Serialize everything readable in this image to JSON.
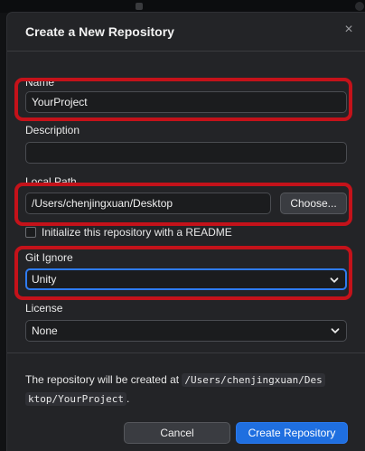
{
  "dialog": {
    "title": "Create a New Repository",
    "close_glyph": "×"
  },
  "fields": {
    "name_label": "Name",
    "name_value": "YourProject",
    "description_label": "Description",
    "description_value": "",
    "local_path_label": "Local Path",
    "local_path_value": "/Users/chenjingxuan/Desktop",
    "choose_button": "Choose...",
    "readme_checkbox_label": "Initialize this repository with a README",
    "readme_checked": false,
    "gitignore_label": "Git Ignore",
    "gitignore_value": "Unity",
    "license_label": "License",
    "license_value": "None"
  },
  "footer": {
    "text_prefix": "The repository will be created at ",
    "path_part1": "/Users/chenjingxuan/Des",
    "path_part2": "ktop/YourProject",
    "text_suffix": ".",
    "cancel_button": "Cancel",
    "create_button": "Create Repository"
  },
  "colors": {
    "accent": "#1f6fe0",
    "annotation_red": "#c4121a"
  },
  "icons": {
    "close": "close-icon",
    "select_chevron": "chevron-down-icon"
  }
}
